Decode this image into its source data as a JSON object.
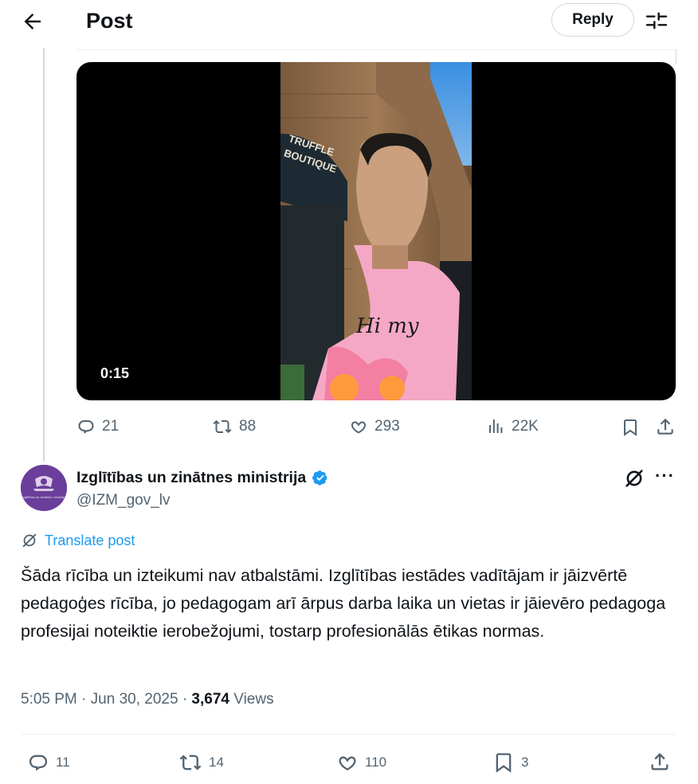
{
  "header": {
    "title": "Post",
    "reply_label": "Reply"
  },
  "quoted_video": {
    "duration": "0:15",
    "sign_line1": "TRUFFLE",
    "sign_line2": "BOUTIQUE",
    "shirt_text": "Hi my"
  },
  "quoted_actions": {
    "replies": "21",
    "reposts": "88",
    "likes": "293",
    "views": "22K"
  },
  "post": {
    "author_name": "Izglītības un zinātnes ministrija",
    "handle": "@IZM_gov_lv",
    "translate_label": "Translate post",
    "text": "Šāda rīcība un izteikumi nav atbalstāmi. Izglītības iestādes vadītājam ir jāizvērtē pedagoģes rīcība, jo pedagogam arī ārpus darba laika un vietas ir jāievēro pedagoga profesijai noteiktie ierobežojumi, tostarp profesionālās ētikas normas.",
    "time": "5:05 PM",
    "date": "Jun 30, 2025",
    "views_count": "3,674",
    "views_label": "Views",
    "avatar_caption": "Izglītības un zinātnes ministrija"
  },
  "post_actions": {
    "replies": "11",
    "reposts": "14",
    "likes": "110",
    "bookmarks": "3"
  },
  "colors": {
    "accent": "#1d9bf0",
    "muted": "#536471",
    "avatar_bg": "#6a3e9a"
  }
}
